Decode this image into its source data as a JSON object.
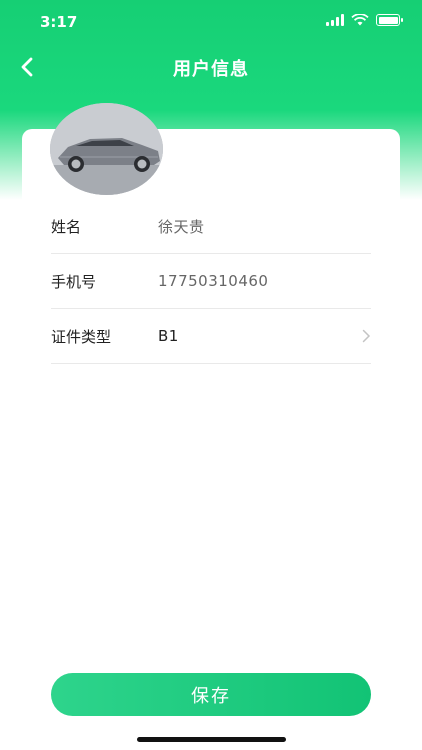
{
  "status_bar": {
    "time": "3:17"
  },
  "nav": {
    "title": "用户信息",
    "back_icon": "chevron-left-icon"
  },
  "profile": {
    "avatar": "car-photo"
  },
  "form": {
    "rows": [
      {
        "label": "姓名",
        "value": "徐天贵"
      },
      {
        "label": "手机号",
        "value": "17750310460"
      },
      {
        "label": "证件类型",
        "value": "B1"
      }
    ]
  },
  "footer": {
    "save_label": "保存"
  },
  "colors": {
    "accent": "#16cf74",
    "button": "#1bc87a",
    "divider": "#e9e9e9"
  }
}
